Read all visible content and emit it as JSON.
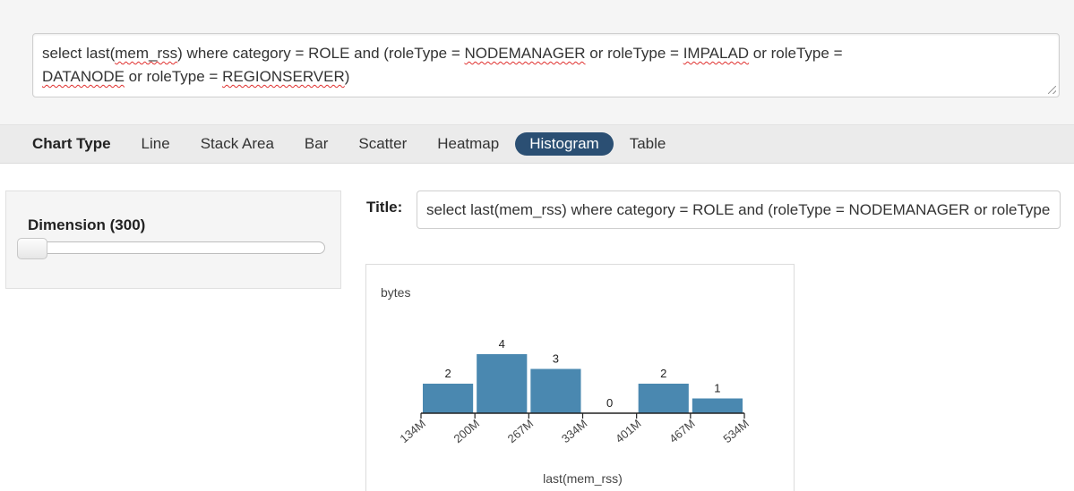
{
  "query": {
    "parts": [
      {
        "text": "select last(",
        "spell": false
      },
      {
        "text": "mem_rss",
        "spell": true
      },
      {
        "text": ") where category = ROLE and (roleType = ",
        "spell": false
      },
      {
        "text": "NODEMANAGER",
        "spell": true
      },
      {
        "text": " or roleType = ",
        "spell": false
      },
      {
        "text": "IMPALAD",
        "spell": true
      },
      {
        "text": " or roleType = \n",
        "spell": false
      },
      {
        "text": "DATANODE",
        "spell": true
      },
      {
        "text": " or roleType = ",
        "spell": false
      },
      {
        "text": "REGIONSERVER",
        "spell": true
      },
      {
        "text": ")",
        "spell": false
      }
    ]
  },
  "chart_types": {
    "label": "Chart Type",
    "items": [
      "Line",
      "Stack Area",
      "Bar",
      "Scatter",
      "Heatmap",
      "Histogram",
      "Table"
    ],
    "selected": "Histogram"
  },
  "dimension": {
    "label": "Dimension (300)",
    "slider_value": 300
  },
  "title_field": {
    "label": "Title:",
    "value": "select last(mem_rss) where category = ROLE and (roleType = NODEMANAGER or roleType = IMPALAD or roleType = DATANODE or roleType = REGIONSERVER)"
  },
  "chart_data": {
    "type": "bar",
    "title": "",
    "ylabel": "bytes",
    "xlabel": "last(mem_rss)",
    "tick_labels": [
      "134M",
      "200M",
      "267M",
      "334M",
      "401M",
      "467M",
      "534M"
    ],
    "bins": [
      {
        "from": "134M",
        "to": "200M",
        "count": 2
      },
      {
        "from": "200M",
        "to": "267M",
        "count": 4
      },
      {
        "from": "267M",
        "to": "334M",
        "count": 3
      },
      {
        "from": "334M",
        "to": "401M",
        "count": 0
      },
      {
        "from": "401M",
        "to": "467M",
        "count": 2
      },
      {
        "from": "467M",
        "to": "534M",
        "count": 1
      }
    ],
    "ylim": [
      0,
      4
    ],
    "bar_color": "#4a88b0"
  }
}
